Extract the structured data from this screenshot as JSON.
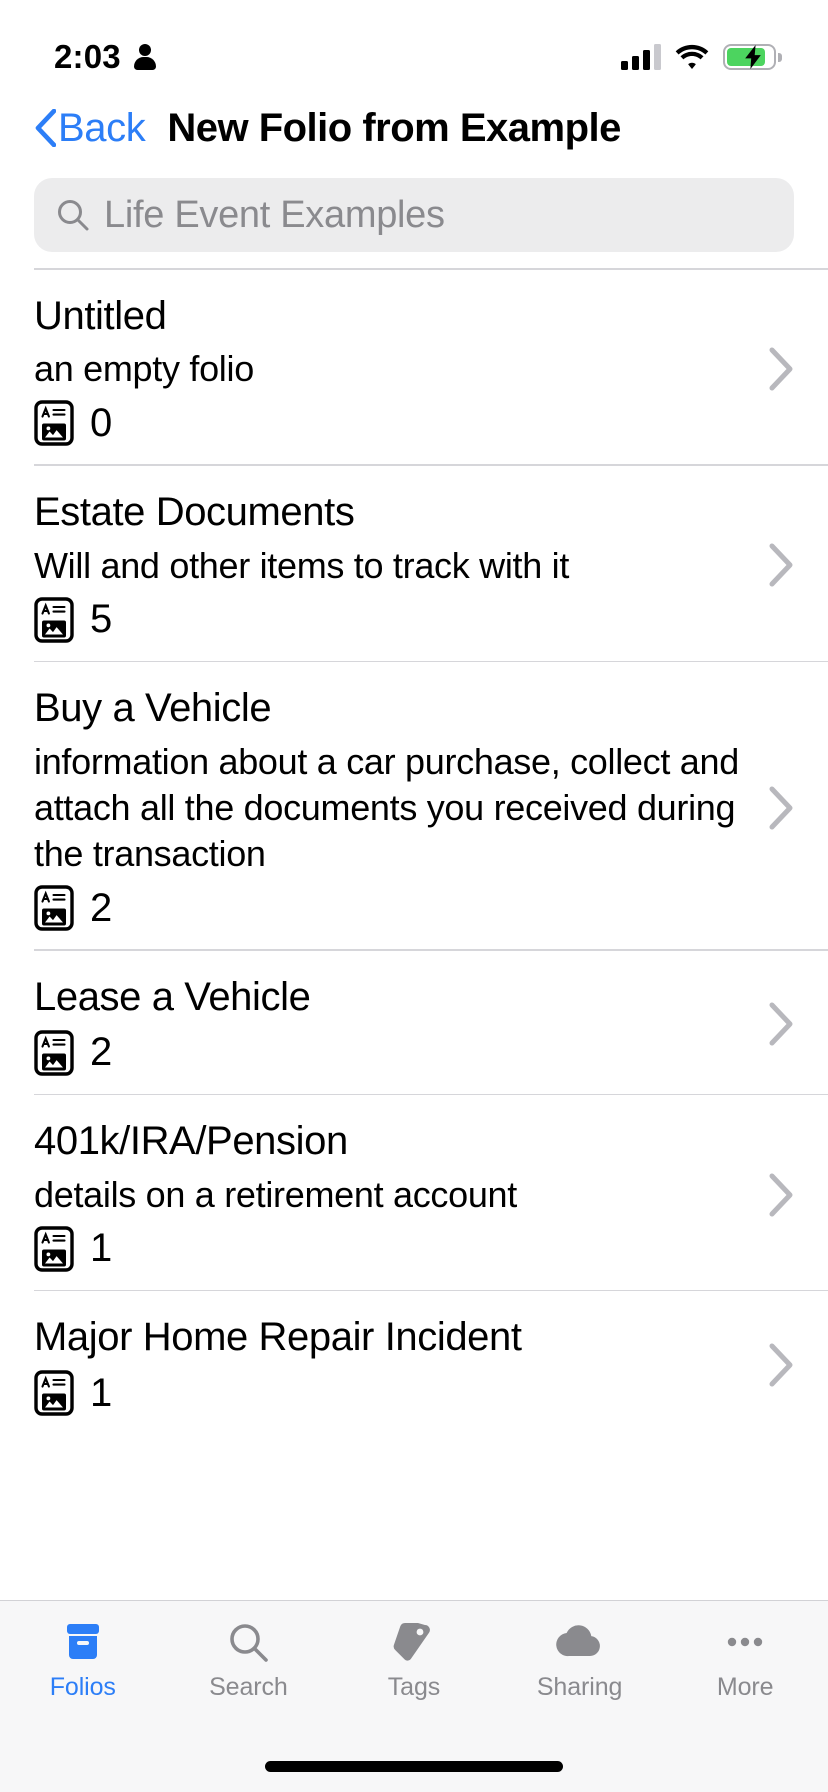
{
  "status_bar": {
    "time": "2:03",
    "person_icon": "person-icon",
    "cellular_icon": "cellular-bars-icon",
    "wifi_icon": "wifi-icon",
    "battery_icon": "battery-charging-icon",
    "battery_color": "#4cd45f"
  },
  "nav": {
    "back_label": "Back",
    "back_icon": "chevron-left-icon",
    "title": "New Folio from Example",
    "accent_color": "#2c7ef7"
  },
  "search": {
    "placeholder": "Life Event Examples",
    "value": "",
    "icon": "search-icon",
    "background": "#ececed"
  },
  "list": {
    "count_icon": "card-richtext-icon",
    "disclosure_icon": "chevron-right-icon",
    "items": [
      {
        "title": "Untitled",
        "subtitle": "an empty folio",
        "count": "0"
      },
      {
        "title": "Estate Documents",
        "subtitle": "Will and other items to track with it",
        "count": "5"
      },
      {
        "title": "Buy a Vehicle",
        "subtitle": "information about a car purchase, collect and attach all the documents you received during the transaction",
        "count": "2"
      },
      {
        "title": "Lease a Vehicle",
        "subtitle": "",
        "count": "2"
      },
      {
        "title": "401k/IRA/Pension",
        "subtitle": "details on a retirement account",
        "count": "1"
      },
      {
        "title": "Major Home Repair Incident",
        "subtitle": "",
        "count": "1"
      }
    ]
  },
  "tab_bar": {
    "active_color": "#2c7ef7",
    "inactive_color": "#8a8a8e",
    "tabs": [
      {
        "label": "Folios",
        "icon": "folios-archivebox-icon",
        "active": true
      },
      {
        "label": "Search",
        "icon": "search-icon",
        "active": false
      },
      {
        "label": "Tags",
        "icon": "tag-icon",
        "active": false
      },
      {
        "label": "Sharing",
        "icon": "cloud-icon",
        "active": false
      },
      {
        "label": "More",
        "icon": "ellipsis-icon",
        "active": false
      }
    ]
  }
}
